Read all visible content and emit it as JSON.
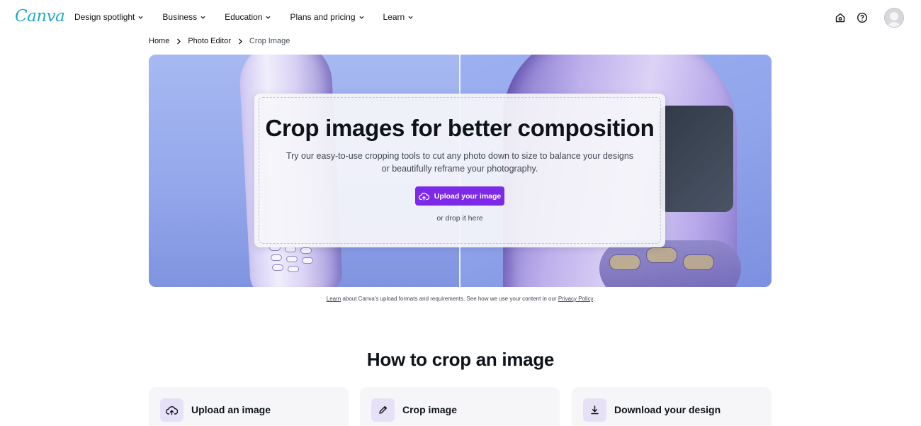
{
  "brand": {
    "logo_text": "Canva",
    "accent": "#7d2ae8",
    "logo_color": "#1fa8c9"
  },
  "nav": {
    "menu": [
      {
        "label": "Design spotlight"
      },
      {
        "label": "Business"
      },
      {
        "label": "Education"
      },
      {
        "label": "Plans and pricing"
      },
      {
        "label": "Learn"
      }
    ],
    "right_icons": [
      "home-icon",
      "help-icon",
      "avatar"
    ]
  },
  "breadcrumb": [
    "Home",
    "Photo Editor",
    "Crop Image"
  ],
  "hero": {
    "title": "Crop images for better composition",
    "subtitle": "Try our easy-to-use cropping tools to cut any photo down to size to balance your designs or beautifully reframe your photography.",
    "upload_button": "Upload your image",
    "drop_text": "or drop it here"
  },
  "footnote": {
    "learn_link": "Learn",
    "text_1": " about Canva's upload formats and requirements. See how we use your content in our ",
    "privacy_link": "Privacy Policy",
    "text_2": "."
  },
  "how_to": {
    "title": "How to crop an image",
    "steps": [
      {
        "label": "Upload an image",
        "icon": "cloud-upload-icon"
      },
      {
        "label": "Crop image",
        "icon": "pencil-icon"
      },
      {
        "label": "Download your design",
        "icon": "download-icon"
      }
    ]
  }
}
